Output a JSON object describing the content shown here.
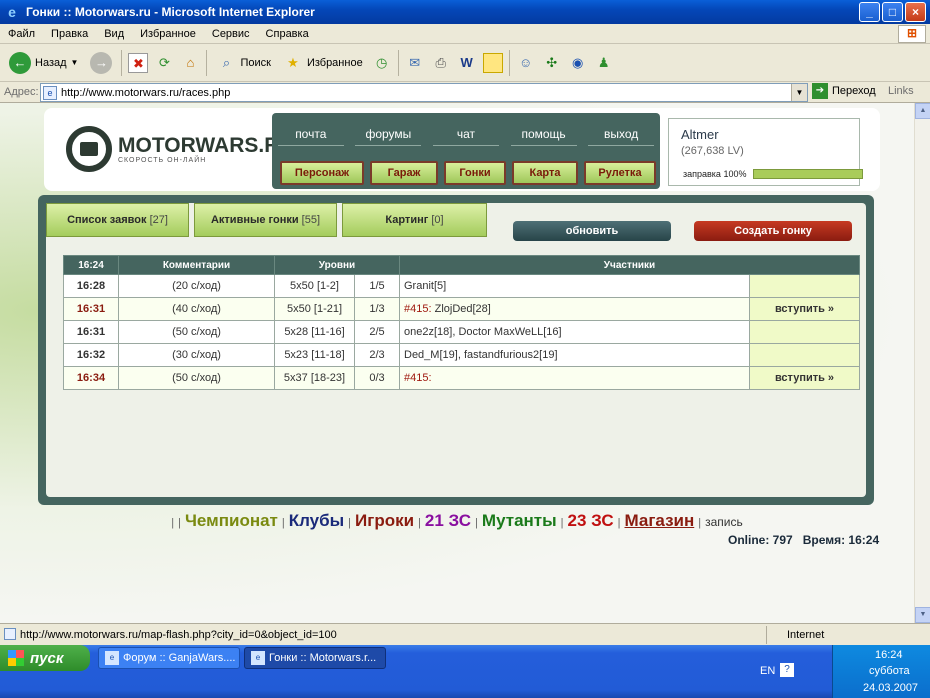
{
  "window": {
    "title": "Гонки :: Motorwars.ru - Microsoft Internet Explorer"
  },
  "menu": [
    "Файл",
    "Правка",
    "Вид",
    "Избранное",
    "Сервис",
    "Справка"
  ],
  "toolbar": {
    "back": "Назад",
    "search": "Поиск",
    "favorites": "Избранное"
  },
  "address": {
    "label": "Адрес:",
    "url": "http://www.motorwars.ru/races.php",
    "go": "Переход",
    "links": "Links"
  },
  "site": {
    "logo_name": "MOTORWARS.RU",
    "logo_tag": "СКОРОСТЬ ОН-ЛАЙН",
    "top_nav": [
      "почта",
      "форумы",
      "чат",
      "помощь",
      "выход"
    ],
    "main_nav": [
      "Персонаж",
      "Гараж",
      "Гонки",
      "Карта",
      "Рулетка"
    ],
    "user": {
      "name": "Altmer",
      "balance": "(267,638 LV)",
      "fuel_label": "заправка 100%",
      "fuel_percent": 100
    }
  },
  "tabs": [
    {
      "label": "Список заявок",
      "count": "[27]"
    },
    {
      "label": "Активные гонки",
      "count": "[55]"
    },
    {
      "label": "Картинг",
      "count": "[0]"
    }
  ],
  "buttons": {
    "refresh": "обновить",
    "create": "Создать гонку"
  },
  "table": {
    "headers": [
      "16:24",
      "Комментарии",
      "Уровни",
      "Участники"
    ],
    "rows": [
      {
        "time": "16:28",
        "comment": "(20 с/ход)",
        "size": "5x50",
        "range": "[1-2]",
        "count": "1/5",
        "race_id": "",
        "participants": [
          {
            "name": "Granit",
            "level": "[5]"
          }
        ],
        "join": ""
      },
      {
        "time": "16:31",
        "comment": "(40 с/ход)",
        "size": "5x50",
        "range": "[1-21]",
        "count": "1/3",
        "race_id": "#415:",
        "participants": [
          {
            "name": "ZlojDed",
            "level": "[28]"
          }
        ],
        "join": "вступить »"
      },
      {
        "time": "16:31",
        "comment": "(50 с/ход)",
        "size": "5x28",
        "range": "[11-16]",
        "count": "2/5",
        "race_id": "",
        "participants": [
          {
            "name": "one2z",
            "level": "[18]"
          },
          {
            "name": "Doctor MaxWeLL",
            "level": "[16]"
          }
        ],
        "join": ""
      },
      {
        "time": "16:32",
        "comment": "(30 с/ход)",
        "size": "5x23",
        "range": "[11-18]",
        "count": "2/3",
        "race_id": "",
        "participants": [
          {
            "name": "Ded_M",
            "level": "[19]"
          },
          {
            "name": "fastandfurious2",
            "level": "[19]"
          }
        ],
        "join": ""
      },
      {
        "time": "16:34",
        "comment": "(50 с/ход)",
        "size": "5x37",
        "range": "[18-23]",
        "count": "0/3",
        "race_id": "#415:",
        "participants": [],
        "join": "вступить »"
      }
    ]
  },
  "footer": {
    "links": [
      {
        "text": "Чемпионат",
        "color": "#7a8a10"
      },
      {
        "text": "Клубы",
        "color": "#1a2a7a"
      },
      {
        "text": "Игроки",
        "color": "#8a1c10"
      },
      {
        "text": "21 ЗС",
        "color": "#8a10a0"
      },
      {
        "text": "Мутанты",
        "color": "#1a7a1a"
      },
      {
        "text": "23 ЗС",
        "color": "#c01010"
      },
      {
        "text": "Магазин",
        "color": "#8a1c10"
      }
    ],
    "signup": "запись",
    "online": "Online: 797",
    "time": "Время: 16:24"
  },
  "status": {
    "text": "http://www.motorwars.ru/map-flash.php?city_id=0&object_id=100",
    "zone": "Internet"
  },
  "taskbar": {
    "start": "пуск",
    "tasks": [
      "Форум :: GanjaWars....",
      "Гонки :: Motorwars.r..."
    ],
    "lang": "EN",
    "clock": "16:24",
    "day": "суббота",
    "date": "24.03.2007"
  }
}
